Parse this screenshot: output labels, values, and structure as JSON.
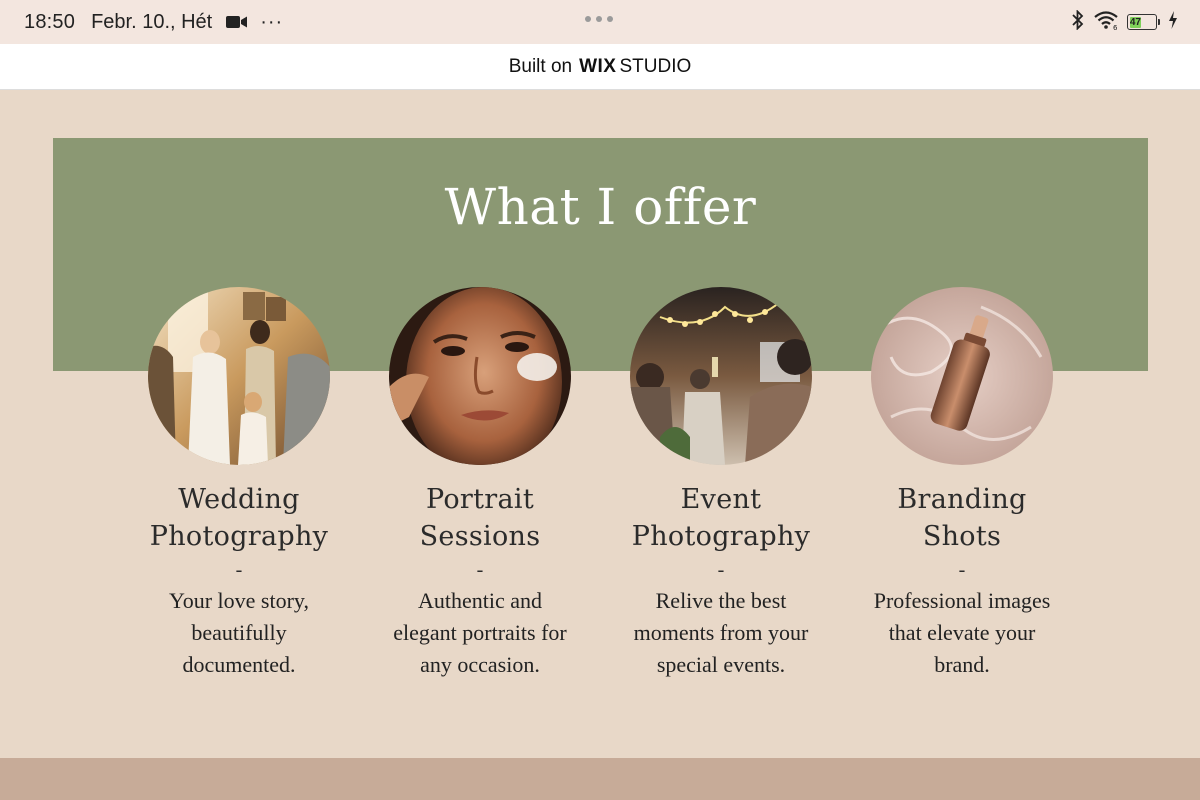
{
  "status_bar": {
    "time": "18:50",
    "date": "Febr. 10., Hét",
    "more": "···",
    "battery_level": "47",
    "icons": [
      "video-camera-icon",
      "bluetooth-icon",
      "wifi-icon",
      "battery-icon",
      "charging-icon"
    ]
  },
  "wix_banner": {
    "prefix": "Built on",
    "brand": "WIX",
    "product": "STUDIO"
  },
  "section": {
    "title": "What I offer",
    "colors": {
      "panel": "#8b9873",
      "background": "#e8d8c8",
      "footer": "#c7ab98"
    }
  },
  "services": [
    {
      "title_line1": "Wedding",
      "title_line2": "Photography",
      "dash": "-",
      "desc_line1": "Your love story,",
      "desc_line2": "beautifully",
      "desc_line3": "documented."
    },
    {
      "title_line1": "Portrait",
      "title_line2": "Sessions",
      "dash": "-",
      "desc_line1": "Authentic and",
      "desc_line2": "elegant portraits for",
      "desc_line3": "any occasion."
    },
    {
      "title_line1": "Event",
      "title_line2": "Photography",
      "dash": "-",
      "desc_line1": "Relive the best",
      "desc_line2": "moments from your",
      "desc_line3": "special events."
    },
    {
      "title_line1": "Branding",
      "title_line2": "Shots",
      "dash": "-",
      "desc_line1": "Professional images",
      "desc_line2": "that elevate your",
      "desc_line3": "brand."
    }
  ]
}
